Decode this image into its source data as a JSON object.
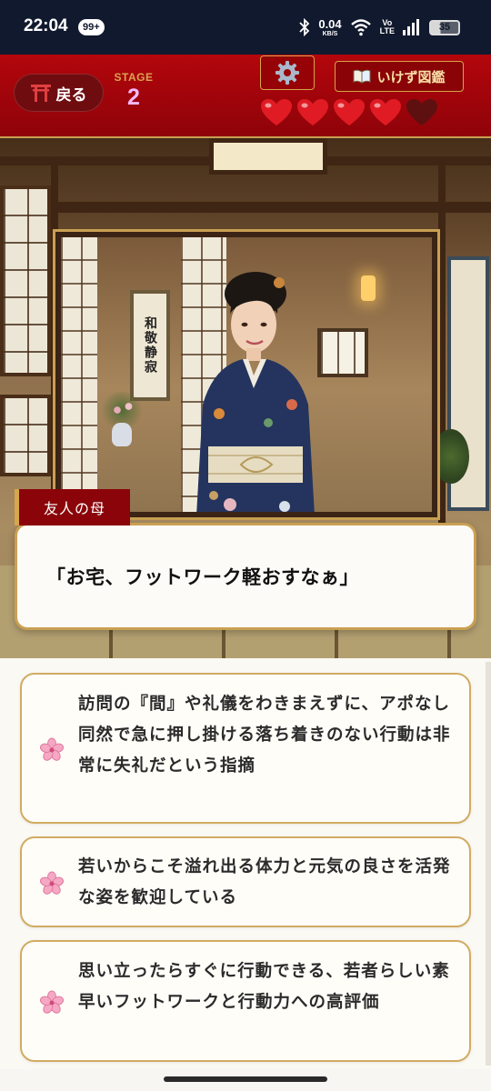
{
  "status_bar": {
    "time": "22:04",
    "notification_badge": "99+",
    "net_speed": "0.04",
    "net_unit": "KB/S",
    "volte": "Vo\nLTE",
    "battery": "35"
  },
  "header": {
    "back_label": "戻る",
    "stage_label": "STAGE",
    "stage_number": "2",
    "zukan_label": "いけず図鑑",
    "lives_total": 5,
    "lives_remaining": 4
  },
  "scene": {
    "scroll_text": "和敬静寂"
  },
  "dialogue": {
    "speaker": "友人の母",
    "text": "「お宅、フットワーク軽おすなぁ」"
  },
  "choices": [
    {
      "text": "訪問の『間』や礼儀をわきまえずに、アポなし同然で急に押し掛ける落ち着きのない行動は非常に失礼だという指摘"
    },
    {
      "text": "若いからこそ溢れ出る体力と元気の良さを活発な姿を歓迎している"
    },
    {
      "text": "思い立ったらすぐに行動できる、若者らしい素早いフットワークと行動力への高評価"
    }
  ],
  "colors": {
    "header_red": "#a5050b",
    "gold": "#c9a052",
    "stage_pink": "#f2b8ff",
    "heart_red": "#e01b24",
    "heart_empty": "#5e1010"
  }
}
